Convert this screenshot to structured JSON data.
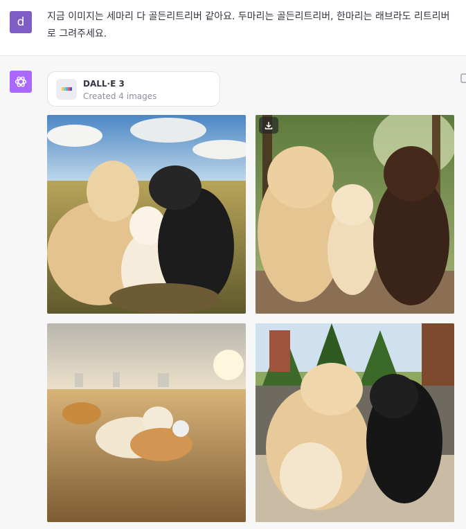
{
  "user": {
    "avatar_letter": "d",
    "message": "지금 이미지는 세마리 다 골든리트리버 같아요. 두마리는 골든리트리버, 한마리는 래브라도 리트리버로 그려주세요."
  },
  "assistant": {
    "tool": {
      "name": "DALL·E 3",
      "subtitle": "Created 4 images"
    },
    "images": [
      {
        "id": "image-1",
        "icon": "dog-photo"
      },
      {
        "id": "image-2",
        "icon": "dog-photo",
        "hover_action": "download-icon"
      },
      {
        "id": "image-3",
        "icon": "dog-photo"
      },
      {
        "id": "image-4",
        "icon": "dog-photo"
      }
    ]
  },
  "colors": {
    "user_avatar": "#7e5ec4",
    "assistant_avatar": "#ab68ff"
  }
}
